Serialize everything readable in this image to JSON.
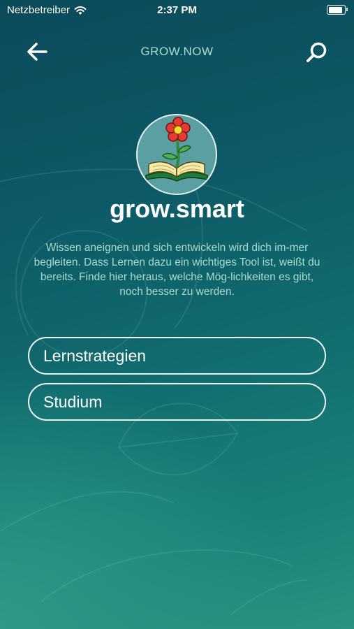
{
  "status_bar": {
    "carrier": "Netzbetreiber",
    "time": "2:37 PM"
  },
  "nav": {
    "title": "GROW.NOW",
    "back_icon": "arrow-left-icon",
    "search_icon": "search-icon"
  },
  "logo": {
    "icon": "flower-book-icon"
  },
  "heading": "grow.smart",
  "description": "Wissen aneignen und sich entwickeln wird dich im-mer begleiten. Dass Lernen dazu ein wichtiges Tool ist, weißt du bereits. Finde hier heraus, welche Mög-lichkeiten es gibt, noch besser zu werden.",
  "buttons": [
    {
      "label": "Lernstrategien"
    },
    {
      "label": "Studium"
    }
  ],
  "colors": {
    "accent_text": "#a9dccd",
    "bg_top": "#0b4a5a",
    "bg_bottom": "#2a9480"
  }
}
